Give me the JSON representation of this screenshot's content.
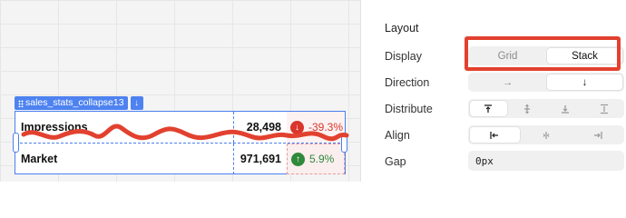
{
  "component_tag": {
    "name": "sales_stats_collapse13",
    "direction_button": "↓"
  },
  "table": {
    "rows": [
      {
        "name": "Impressions",
        "value": "28,498",
        "delta": "-39.3%",
        "trend": "down"
      },
      {
        "name": "Market",
        "value": "971,691",
        "delta": "5.9%",
        "trend": "up"
      }
    ]
  },
  "panel": {
    "title": "Layout",
    "display": {
      "label": "Display",
      "options": [
        "Grid",
        "Stack"
      ],
      "selected": "Stack"
    },
    "direction": {
      "label": "Direction",
      "options": [
        "→",
        "↓"
      ],
      "selected": "↓"
    },
    "distribute": {
      "label": "Distribute",
      "options": [
        "distribute-top-icon",
        "distribute-center-icon",
        "distribute-bottom-icon",
        "distribute-space-between-icon"
      ],
      "selected": "distribute-top-icon"
    },
    "align": {
      "label": "Align",
      "options": [
        "align-left-icon",
        "align-center-icon",
        "align-right-icon"
      ],
      "selected": "align-left-icon"
    },
    "gap": {
      "label": "Gap",
      "value": "0px"
    }
  },
  "colors": {
    "accent": "#4e82f0",
    "negative": "#d9352b",
    "positive": "#2f8a3c",
    "annotation": "#e2412f"
  }
}
